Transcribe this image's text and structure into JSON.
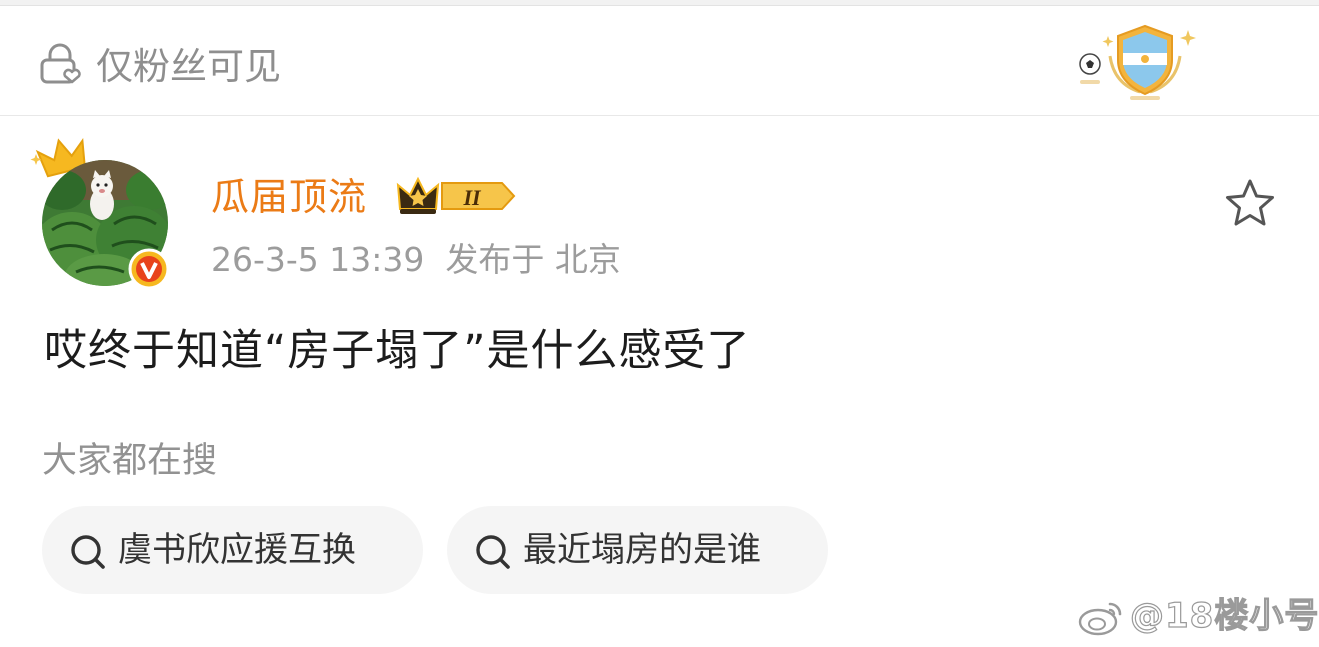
{
  "privacy": {
    "label": "仅粉丝可见",
    "icon": "lock-heart-icon"
  },
  "header_badge": {
    "icon": "argentina-shield-trophy-icon",
    "secondary_icon": "soccer-ball-icon"
  },
  "post": {
    "author": {
      "name": "瓜届顶流",
      "avatar": "watermelon-kitten-avatar",
      "avatar_crown_icon": "crown-icon",
      "verified_badge": "V",
      "vip_badge_level": "II"
    },
    "timestamp": "26-3-5 13:39",
    "location_prefix": "发布于",
    "location": "北京",
    "body": "哎终于知道“房子塌了”是什么感受了",
    "favorite_icon": "star-outline-icon"
  },
  "searches": {
    "heading": "大家都在搜",
    "items": [
      {
        "label": "虞书欣应援互换",
        "icon": "search-icon"
      },
      {
        "label": "最近塌房的是谁",
        "icon": "search-icon"
      }
    ]
  },
  "watermark": {
    "text": "@18楼小号",
    "icon": "weibo-logo-icon"
  },
  "colors": {
    "username": "#eb7b16",
    "muted": "#9c9c9c",
    "chip_bg": "#f5f5f5",
    "accent_gold": "#f5b31a"
  }
}
